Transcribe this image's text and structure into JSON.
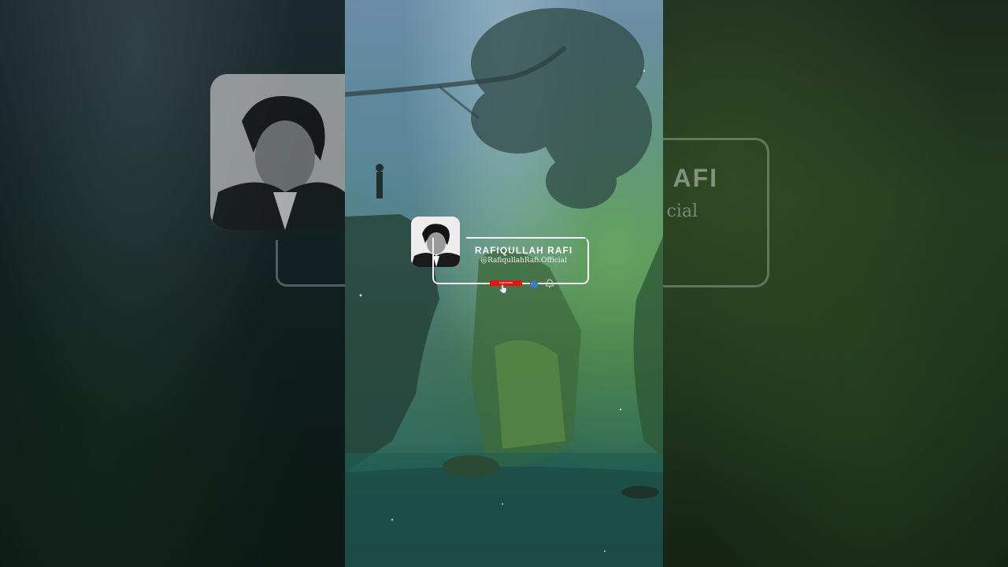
{
  "channel": {
    "name": "RAFIQULLAH RAFI",
    "handle": "@RafiqullahRafi.Official"
  },
  "buttons": {
    "subscribe_label": "SUBSCRIBE"
  },
  "side_ghost": {
    "name_fragment": "AFI",
    "handle_fragment": "cial"
  },
  "icons": {
    "like": "thumbs-up-icon",
    "bell": "bell-icon",
    "cursor": "hand-pointer-icon"
  },
  "colors": {
    "subscribe": "#e01616",
    "like": "#3b7bd8",
    "frame": "#f2f2f2"
  }
}
